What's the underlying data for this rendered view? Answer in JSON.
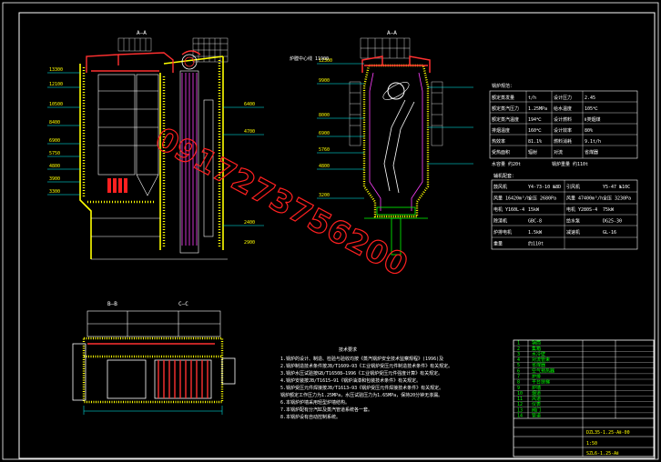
{
  "drawing": {
    "watermark": "0917273756200",
    "section_labels": [
      "A—A",
      "A—A",
      "B—B",
      "C—C"
    ],
    "elevations_left": [
      "13300",
      "12100",
      "10500",
      "8400",
      "6900",
      "5750",
      "4800",
      "3900",
      "3300"
    ],
    "elevations_right": [
      "12300",
      "9900",
      "8000",
      "6900",
      "5760",
      "4800",
      "3200"
    ],
    "elevations_mid": [
      "6400",
      "4700",
      "2400",
      "2900"
    ],
    "callout": "炉膛中心线 11900"
  },
  "params_table": {
    "title": "锅炉规范：",
    "rows": [
      [
        "额定蒸发量",
        "t/h",
        "设计压力",
        "2.45"
      ],
      [
        "额定蒸汽压力",
        "1.25MPa",
        "给水温度",
        "105℃"
      ],
      [
        "额定蒸汽温度",
        "194℃",
        "设计燃料",
        "Ⅱ类烟煤"
      ],
      [
        "排烟温度",
        "160℃",
        "设计效率",
        "80%"
      ],
      [
        "热效率",
        "81.1%",
        "燃料消耗",
        "9.1t/h"
      ],
      [
        "受热面积",
        "辐射",
        "对流",
        "省煤器"
      ]
    ],
    "footer": [
      "水容量 约20t",
      "锅炉重量 约110t"
    ]
  },
  "equip_table": {
    "title": "辅机配套：",
    "rows": [
      [
        "鼓风机",
        "Y4-73-10 №8D",
        "引风机",
        "Y5-47 №10C"
      ],
      [
        "风量 16420m³/h",
        "全压 2680Pa",
        "风量 47400m³/h",
        "全压 3230Pa"
      ],
      [
        "电机 Y160L-4",
        "15kW",
        "电机 Y280S-4",
        "75kW"
      ],
      [
        "除渣机",
        "GBC-8",
        "给水泵",
        "DG25-30"
      ],
      [
        "炉排电机",
        "1.5kW",
        "减速机",
        "GL-16"
      ],
      [
        "重量",
        "约110t",
        "",
        ""
      ]
    ]
  },
  "notes": {
    "title": "技术要求",
    "lines": [
      "1.锅炉的设计、制造、检验与验收均按《蒸汽锅炉安全技术监察规程》(1996)及",
      "2.锅炉制造技术条件按JB/T1609—93《工业锅炉受压元件制造技术条件》有关规定。",
      "3.锅炉水压试验按GB/T16508—1996《工业锅炉受压元件强度计算》有关规定。",
      "4.锅炉安装按JB/T1615—91《锅炉油漆和包装技术条件》有关规定。",
      "5.锅炉受压元件焊接按JB/T1613—93《锅炉受压元件焊接技术条件》有关规定。",
      "  锅炉额定工作压力为1.25MPa，水压试验压力为1.65MPa，保持20分钟无渗漏。",
      "6.本锅炉炉墙采用轻型炉墙结构。",
      "7.本锅炉配有分汽缸及蒸汽管道系统各一套。",
      "8.本锅炉设有自动控制系统。"
    ]
  },
  "title_block": {
    "drawing_no": "DZL35-1.25-AⅡ-00",
    "scale": "1:50",
    "footer": "SZL6-1.25-AⅡ",
    "rows": [
      "锅筒",
      "集箱",
      "水冷壁",
      "对流管束",
      "省煤器",
      "空气预热器",
      "炉排",
      "平台扶梯",
      "炉墙",
      "烟道",
      "风道",
      "仪表",
      "阀门",
      "管道"
    ]
  }
}
